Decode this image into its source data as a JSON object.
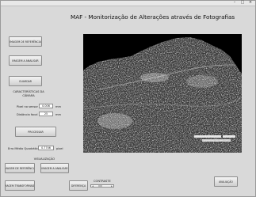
{
  "window": {
    "controls": [
      "–",
      "□",
      "×"
    ]
  },
  "app_title": "MAF - Monitorização de Alterações através de Fotografias",
  "buttons": {
    "ref_image": "IMAGEM DE REFERÊNCIA",
    "analyze_image": "IMAGEM A ANALISAR",
    "save": "GUARDAR",
    "process": "PROCESSAR",
    "ref_image_view": "IMAGEM DE REFERÊNCIA",
    "analyze_image_view": "IMAGEM A ANALISAR",
    "transformed_image": "IMAGEM TRANSFORMADA",
    "difference": "DIFERENÇA",
    "evaluation": "AVALIAÇÃO"
  },
  "camera": {
    "heading_line1": "CARACTERÍSTICAS DA",
    "heading_line2": "CÂMARA",
    "pixel_size_label": "Pixel no sensor",
    "pixel_size_value": "0.006",
    "pixel_size_unit": "mm",
    "focal_label": "Distância focal",
    "focal_value": "25",
    "focal_unit": "mm"
  },
  "rms": {
    "label": "Erro Médio Quadrático",
    "value": "0.7746",
    "unit": "pixel"
  },
  "view": {
    "heading": "VISUALIZAÇÃO"
  },
  "contrast": {
    "label": "CONTRASTE",
    "level": 0.35
  }
}
